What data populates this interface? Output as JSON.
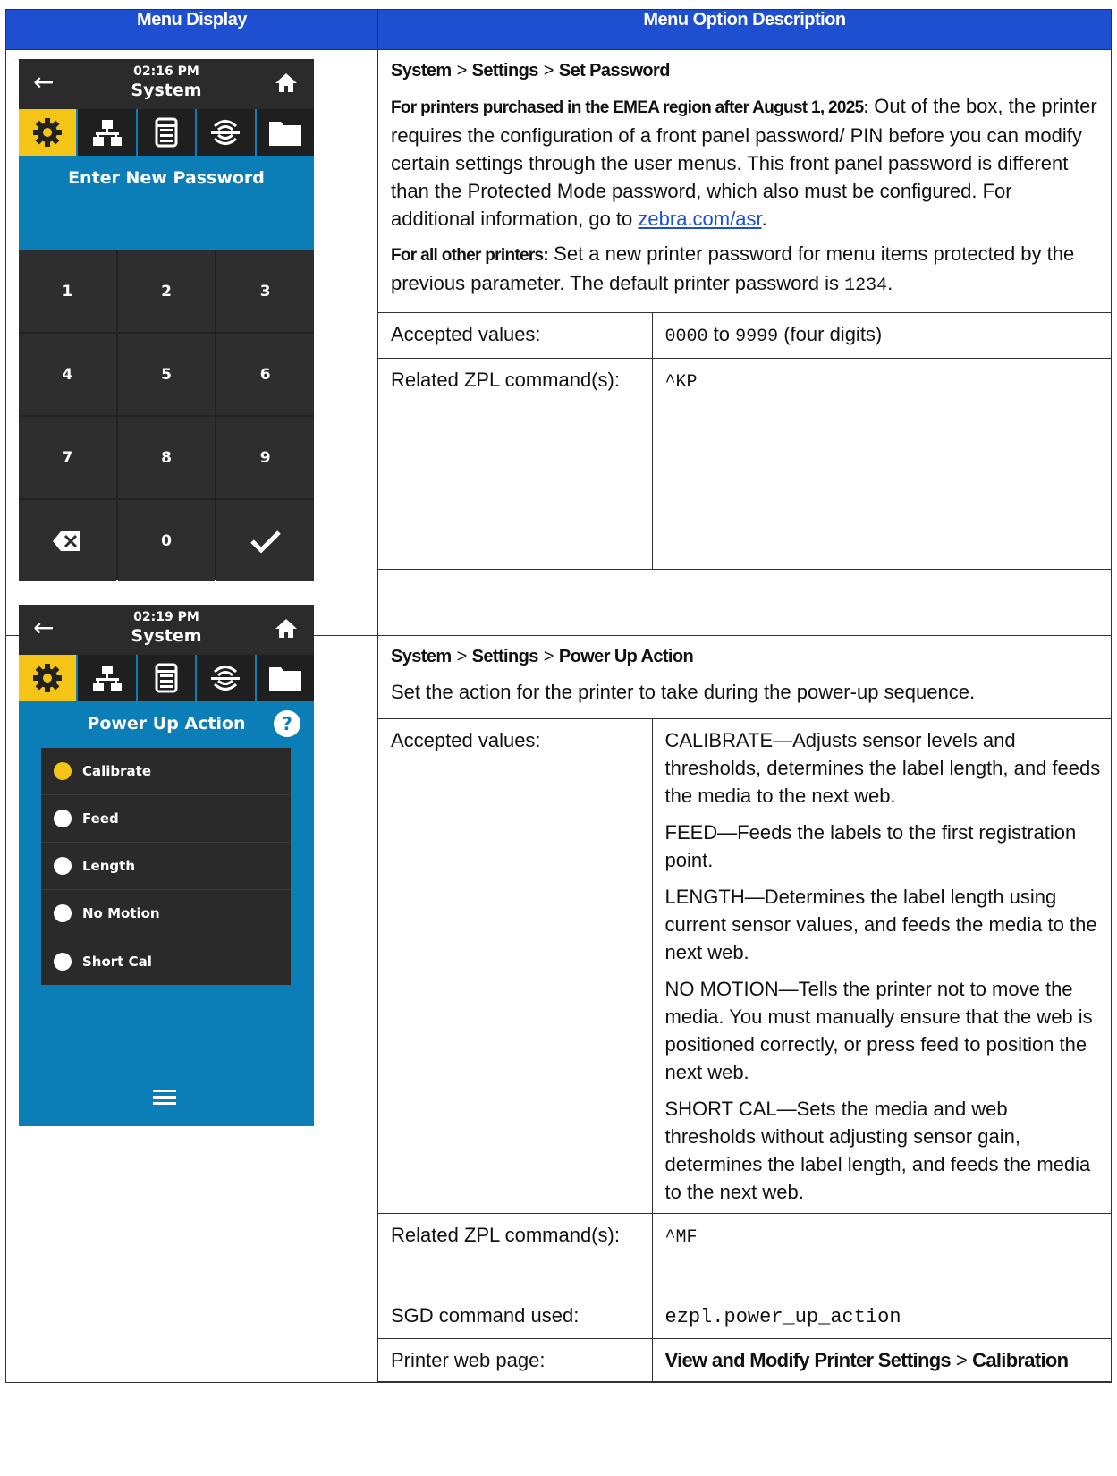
{
  "header": {
    "col1": "Menu Display",
    "col2": "Menu Option Description"
  },
  "screen1": {
    "time": "02:16 PM",
    "title": "System",
    "dialog_title": "Enter New Password",
    "keys": [
      "1",
      "2",
      "3",
      "4",
      "5",
      "6",
      "7",
      "8",
      "9",
      "",
      "0",
      ""
    ]
  },
  "screen2": {
    "time": "02:19 PM",
    "title": "System",
    "dialog_title": "Power Up Action",
    "help": "?",
    "options": [
      {
        "label": "Calibrate",
        "selected": true
      },
      {
        "label": "Feed",
        "selected": false
      },
      {
        "label": "Length",
        "selected": false
      },
      {
        "label": "No Motion",
        "selected": false
      },
      {
        "label": "Short Cal",
        "selected": false
      }
    ]
  },
  "sec1": {
    "path": [
      "System",
      ">",
      "Settings",
      ">",
      "Set Password"
    ],
    "emea_lead": "For printers purchased in the EMEA region after August 1, 2025:",
    "emea_text": " Out of the box, the printer requires the configuration of a front panel password/ PIN before you can modify certain settings through the user menus. This front panel password is different than the Protected Mode password, which also must be configured. For additional information, go to ",
    "link": "zebra.com/asr",
    "link_end": ".",
    "other_lead": "For all other printers:",
    "other_text": " Set a new printer password for menu items protected by the previous parameter. The default printer password is ",
    "default_pw": "1234",
    "other_end": ".",
    "accepted_label": "Accepted values:",
    "accepted_min": "0000",
    "accepted_to": " to ",
    "accepted_max": "9999",
    "accepted_note": " (four digits)",
    "zpl_label": "Related ZPL command(s):",
    "zpl_value": "^KP"
  },
  "sec2": {
    "path": [
      "System",
      ">",
      "Settings",
      ">",
      "Power Up Action"
    ],
    "desc": "Set the action for the printer to take during the power-up sequence.",
    "accepted_label": "Accepted values:",
    "values": [
      "CALIBRATE—Adjusts sensor levels and thresholds, determines the label length, and feeds the media to the next web.",
      "FEED—Feeds the labels to the first registration point.",
      "LENGTH—Determines the label length using current sensor values, and feeds the media to the next web.",
      "NO MOTION—Tells the printer not to move the media. You must manually ensure that the web is positioned correctly, or press feed to position the next web.",
      "SHORT CAL—Sets the media and web thresholds without adjusting sensor gain, determines the label length, and feeds the media to the next web."
    ],
    "zpl_label": "Related ZPL command(s):",
    "zpl_value": "^MF",
    "sgd_label": "SGD command used:",
    "sgd_value": "ezpl.power_up_action",
    "web_label": "Printer web page:",
    "web_path": [
      "View and Modify Printer Settings",
      ">",
      "Calibration"
    ]
  },
  "colors": {
    "header_bg": "#1f4fd1",
    "screen_blue": "#0b7eb8",
    "accent_yellow": "#f4c417",
    "dark": "#2b2b2b",
    "link": "#1d4ed8"
  }
}
